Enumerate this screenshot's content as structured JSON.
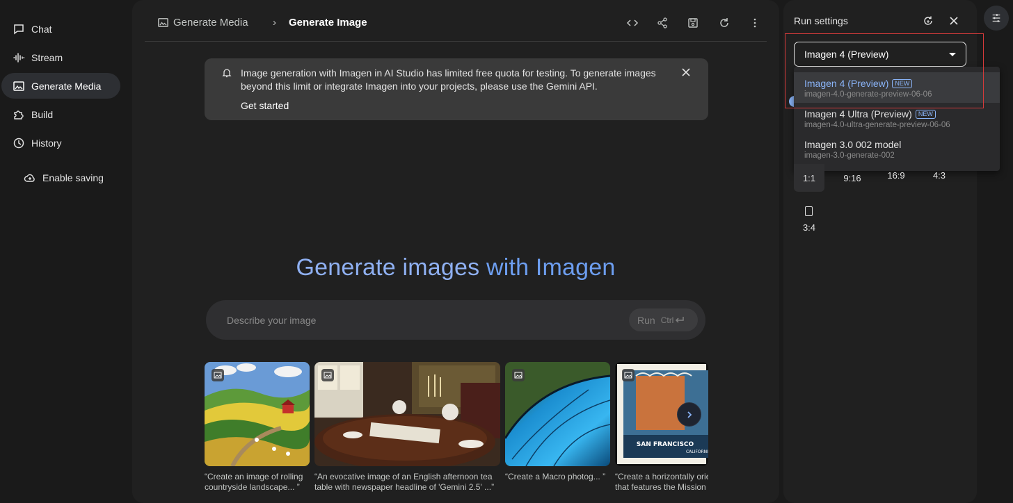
{
  "nav": {
    "items": [
      {
        "label": "Chat",
        "icon": "chat-icon"
      },
      {
        "label": "Stream",
        "icon": "waveform-icon"
      },
      {
        "label": "Generate Media",
        "icon": "image-icon",
        "active": true
      },
      {
        "label": "Build",
        "icon": "puzzle-icon"
      },
      {
        "label": "History",
        "icon": "history-icon"
      }
    ],
    "enable_saving": "Enable saving"
  },
  "header": {
    "crumb_parent": "Generate Media",
    "crumb_current": "Generate Image"
  },
  "banner": {
    "text": "Image generation with Imagen in AI Studio has limited free quota for testing. To generate images beyond this limit or integrate Imagen into your projects, please use the Gemini API.",
    "cta": "Get started"
  },
  "hero": {
    "part1": "Generate images",
    "part2": " with Imagen"
  },
  "prompt": {
    "placeholder": "Describe your image",
    "run_label": "Run",
    "shortcut": "Ctrl"
  },
  "gallery": [
    {
      "caption_line1": "“Create an image of rolling",
      "caption_line2": "countryside landscape... ”"
    },
    {
      "caption_line1": "“An evocative image of an English afternoon tea",
      "caption_line2": "table with newspaper headline of 'Gemini 2.5' ...”"
    },
    {
      "caption_line1": "“Create a Macro photog... ”",
      "caption_line2": ""
    },
    {
      "caption_line1": "“Create a horizontally orier",
      "caption_line2": "that features the Mission D"
    }
  ],
  "stamp_text": {
    "city": "SAN FRANCISCO",
    "state": "CALIFORNIA"
  },
  "run_settings": {
    "title": "Run settings",
    "selected_model": "Imagen 4 (Preview)",
    "models": [
      {
        "name": "Imagen 4 (Preview)",
        "id": "imagen-4.0-generate-preview-06-06",
        "badge": "NEW",
        "selected": true
      },
      {
        "name": "Imagen 4 Ultra (Preview)",
        "id": "imagen-4.0-ultra-generate-preview-06-06",
        "badge": "NEW"
      },
      {
        "name": "Imagen 3.0 002 model",
        "id": "imagen-3.0-generate-002"
      }
    ],
    "aspect_ratios": [
      "1:1",
      "9:16",
      "16:9",
      "4:3",
      "3:4"
    ],
    "selected_aspect": "1:1"
  },
  "colors": {
    "accent": "#8ab4f8",
    "hero_gradient_start": "#8fb0f2",
    "hero_gradient_end": "#6d9ef0",
    "highlight_box": "#d53a3a"
  }
}
